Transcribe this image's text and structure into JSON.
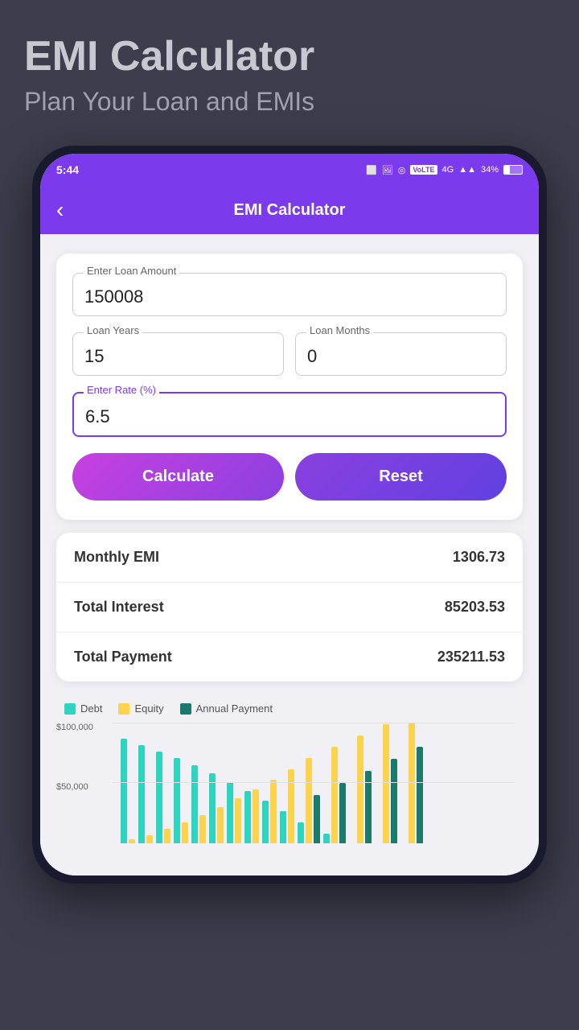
{
  "app": {
    "title": "EMI Calculator",
    "subtitle": "Plan Your Loan and EMIs"
  },
  "status_bar": {
    "time": "5:44",
    "battery_percent": "34%",
    "volte": "VoLTE"
  },
  "header": {
    "back_label": "‹",
    "title": "EMI Calculator"
  },
  "form": {
    "loan_amount_label": "Enter Loan Amount",
    "loan_amount_value": "150008",
    "loan_years_label": "Loan Years",
    "loan_years_value": "15",
    "loan_months_label": "Loan Months",
    "loan_months_value": "0",
    "rate_label": "Enter Rate (%)",
    "rate_value": "6.5",
    "calculate_label": "Calculate",
    "reset_label": "Reset"
  },
  "results": {
    "monthly_emi_label": "Monthly EMI",
    "monthly_emi_value": "1306.73",
    "total_interest_label": "Total Interest",
    "total_interest_value": "85203.53",
    "total_payment_label": "Total Payment",
    "total_payment_value": "235211.53"
  },
  "chart": {
    "legend": [
      {
        "label": "Debt",
        "color": "#2dd4bf"
      },
      {
        "label": "Equity",
        "color": "#fcd34d"
      },
      {
        "label": "Annual Payment",
        "color": "#1a7a6e"
      }
    ],
    "y_labels": [
      "$100,000",
      "$50,000"
    ],
    "bars": [
      {
        "debt": 130,
        "equity": 5,
        "annual": 0
      },
      {
        "debt": 122,
        "equity": 10,
        "annual": 0
      },
      {
        "debt": 114,
        "equity": 18,
        "annual": 0
      },
      {
        "debt": 106,
        "equity": 26,
        "annual": 0
      },
      {
        "debt": 97,
        "equity": 35,
        "annual": 0
      },
      {
        "debt": 87,
        "equity": 45,
        "annual": 0
      },
      {
        "debt": 76,
        "equity": 56,
        "annual": 0
      },
      {
        "debt": 65,
        "equity": 67,
        "annual": 0
      },
      {
        "debt": 53,
        "equity": 79,
        "annual": 0
      },
      {
        "debt": 40,
        "equity": 92,
        "annual": 0
      },
      {
        "debt": 26,
        "equity": 106,
        "annual": 60
      },
      {
        "debt": 12,
        "equity": 120,
        "annual": 75
      },
      {
        "debt": 0,
        "equity": 134,
        "annual": 90
      },
      {
        "debt": 0,
        "equity": 148,
        "annual": 105
      },
      {
        "debt": 0,
        "equity": 150,
        "annual": 120
      }
    ]
  }
}
